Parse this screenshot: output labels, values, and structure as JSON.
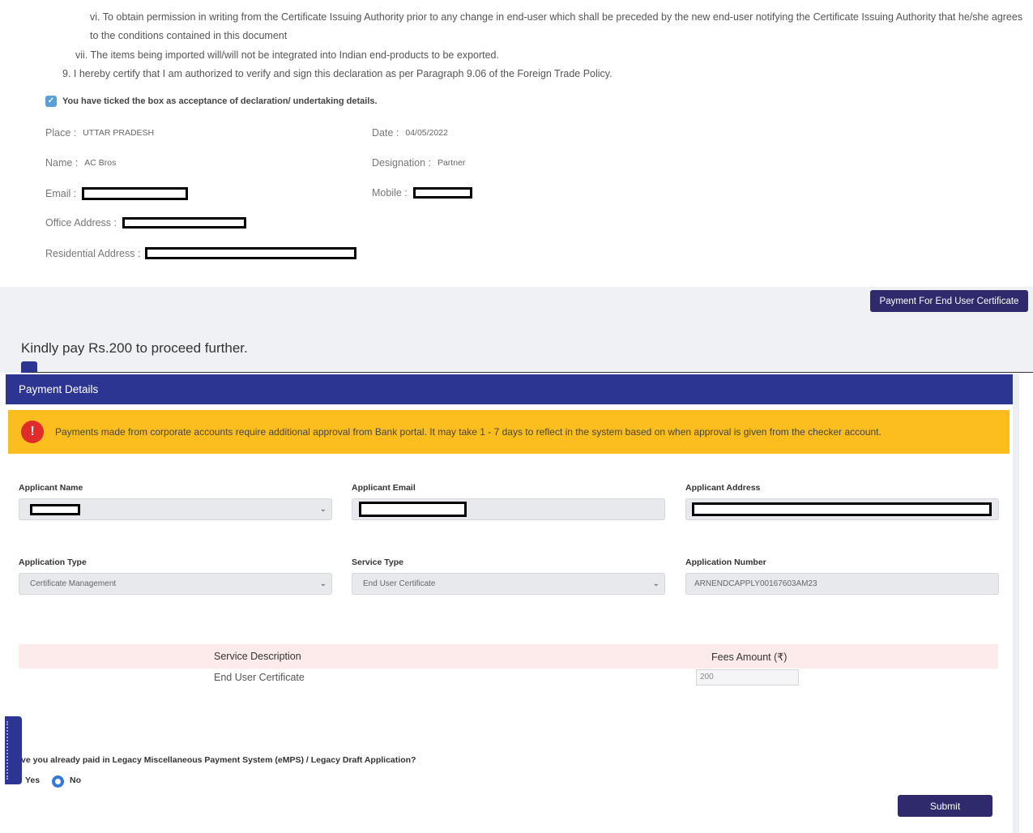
{
  "declaration": {
    "line_vi_a": "vi. To obtain permission in writing from the Certificate Issuing Authority prior to any change in end-user which shall be preceded by the new end-user notifying the Certificate Issuing Authority that he/she agrees",
    "line_vi_b": "to the conditions contained in this document",
    "line_vii": "vii. The items being imported will/will not be integrated into Indian end-products to be exported.",
    "line_9": "9. I hereby certify that I am authorized to verify and sign this declaration as per Paragraph 9.06 of the Foreign Trade Policy.",
    "acceptance_text": "You have ticked the box as acceptance of declaration/ undertaking details.",
    "place_label": "Place :",
    "place_value": "UTTAR PRADESH",
    "date_label": "Date :",
    "date_value": "04/05/2022",
    "name_label": "Name :",
    "name_value": "AC Bros",
    "designation_label": "Designation :",
    "designation_value": "Partner",
    "email_label": "Email :",
    "mobile_label": "Mobile :",
    "office_label": "Office Address :",
    "residential_label": "Residential Address :"
  },
  "pay_cert_button": "Payment For End User Certificate",
  "kindly_pay": "Kindly pay Rs.200 to proceed further.",
  "payment": {
    "header": "Payment Details",
    "alert": "Payments made from corporate accounts require additional approval from Bank portal. It may take 1 - 7 days to reflect in the system based on when approval is given from the checker account.",
    "alert_icon": "!",
    "applicant_name_label": "Applicant Name",
    "applicant_email_label": "Applicant Email",
    "applicant_address_label": "Applicant Address",
    "application_type_label": "Application Type",
    "application_type_value": "Certificate Management",
    "service_type_label": "Service Type",
    "service_type_value": "End User Certificate",
    "application_number_label": "Application Number",
    "application_number_value": "ARNENDCAPPLY00167603AM23",
    "table": {
      "col_service": "Service Description",
      "col_fees": "Fees Amount (₹)",
      "row_service": "End User Certificate",
      "row_fee": "200"
    },
    "legacy_question": "ve you already paid in Legacy Miscellaneous Payment System (eMPS) / Legacy Draft Application?",
    "radio_yes": "Yes",
    "radio_no": "No",
    "submit": "Submit"
  },
  "colors": {
    "header_blue": "#2c3592",
    "button_navy": "#2f2a6b",
    "alert_yellow": "#fbbe1e",
    "alert_red": "#e02b2b"
  },
  "icons": {
    "checkbox": "check-icon",
    "alert": "exclamation-icon",
    "dropdown": "chevron-down-icon"
  }
}
